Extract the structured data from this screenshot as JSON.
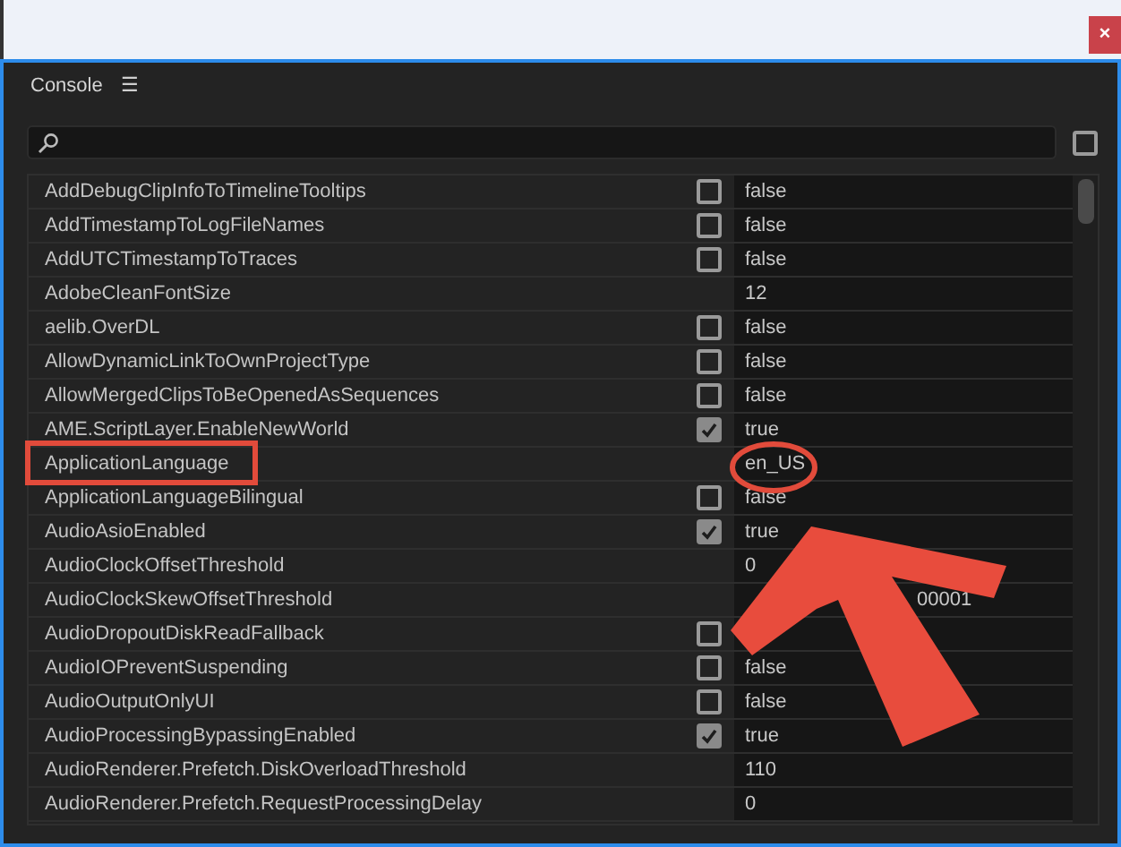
{
  "window": {
    "close": "×"
  },
  "panel": {
    "title": "Console",
    "menu": "☰"
  },
  "search": {
    "filter_checked": false
  },
  "rows": [
    {
      "name": "AddDebugClipInfoToTimelineTooltips",
      "kind": "bool",
      "checked": false,
      "value": "false"
    },
    {
      "name": "AddTimestampToLogFileNames",
      "kind": "bool",
      "checked": false,
      "value": "false"
    },
    {
      "name": "AddUTCTimestampToTraces",
      "kind": "bool",
      "checked": false,
      "value": "false"
    },
    {
      "name": "AdobeCleanFontSize",
      "kind": "text",
      "value": "12"
    },
    {
      "name": "aelib.OverDL",
      "kind": "bool",
      "checked": false,
      "value": "false"
    },
    {
      "name": "AllowDynamicLinkToOwnProjectType",
      "kind": "bool",
      "checked": false,
      "value": "false"
    },
    {
      "name": "AllowMergedClipsToBeOpenedAsSequences",
      "kind": "bool",
      "checked": false,
      "value": "false"
    },
    {
      "name": "AME.ScriptLayer.EnableNewWorld",
      "kind": "bool",
      "checked": true,
      "value": "true"
    },
    {
      "name": "ApplicationLanguage",
      "kind": "text",
      "value": "en_US"
    },
    {
      "name": "ApplicationLanguageBilingual",
      "kind": "bool",
      "checked": false,
      "value": "false"
    },
    {
      "name": "AudioAsioEnabled",
      "kind": "bool",
      "checked": true,
      "value": "true"
    },
    {
      "name": "AudioClockOffsetThreshold",
      "kind": "text",
      "value": "0"
    },
    {
      "name": "AudioClockSkewOffsetThreshold",
      "kind": "text",
      "value": "00001",
      "hidden_start": true
    },
    {
      "name": "AudioDropoutDiskReadFallback",
      "kind": "bool",
      "checked": false
    },
    {
      "name": "AudioIOPreventSuspending",
      "kind": "bool",
      "checked": false,
      "value": "false"
    },
    {
      "name": "AudioOutputOnlyUI",
      "kind": "bool",
      "checked": false,
      "value": "false"
    },
    {
      "name": "AudioProcessingBypassingEnabled",
      "kind": "bool",
      "checked": true,
      "value": "true"
    },
    {
      "name": "AudioRenderer.Prefetch.DiskOverloadThreshold",
      "kind": "text",
      "value": "110"
    },
    {
      "name": "AudioRenderer.Prefetch.RequestProcessingDelay",
      "kind": "text",
      "value": "0"
    }
  ],
  "annotations": [
    {
      "kind": "box"
    },
    {
      "kind": "circle"
    },
    {
      "kind": "arrow"
    }
  ]
}
